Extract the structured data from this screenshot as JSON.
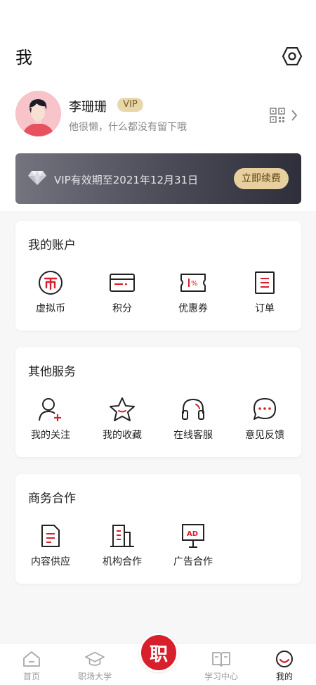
{
  "header": {
    "title": "我"
  },
  "profile": {
    "name": "李珊珊",
    "badge": "VIP",
    "bio": "他很懒，什么都没有留下哦"
  },
  "vip_banner": {
    "text": "VIP有效期至2021年12月31日",
    "button": "立即续费"
  },
  "account": {
    "title": "我的账户",
    "items": [
      {
        "label": "虚拟币",
        "icon": "coin-icon"
      },
      {
        "label": "积分",
        "icon": "card-icon"
      },
      {
        "label": "优惠券",
        "icon": "coupon-icon"
      },
      {
        "label": "订单",
        "icon": "order-icon"
      }
    ]
  },
  "services": {
    "title": "其他服务",
    "items": [
      {
        "label": "我的关注",
        "icon": "follow-icon"
      },
      {
        "label": "我的收藏",
        "icon": "star-icon"
      },
      {
        "label": "在线客服",
        "icon": "headset-icon"
      },
      {
        "label": "意见反馈",
        "icon": "chat-icon"
      }
    ]
  },
  "business": {
    "title": "商务合作",
    "items": [
      {
        "label": "内容供应",
        "icon": "document-icon"
      },
      {
        "label": "机构合作",
        "icon": "building-icon"
      },
      {
        "label": "广告合作",
        "icon": "ad-board-icon"
      }
    ]
  },
  "tabbar": {
    "items": [
      {
        "label": "首页",
        "icon": "home-icon"
      },
      {
        "label": "职场大学",
        "icon": "graduation-cap-icon"
      },
      {
        "label": "学习中心",
        "icon": "book-icon"
      },
      {
        "label": "我的",
        "icon": "profile-face-icon"
      }
    ],
    "center_glyph": "职"
  },
  "colors": {
    "accent": "#d8202c",
    "vip_gold": "#e8cf9e",
    "banner_dark": "#3a3a46"
  }
}
